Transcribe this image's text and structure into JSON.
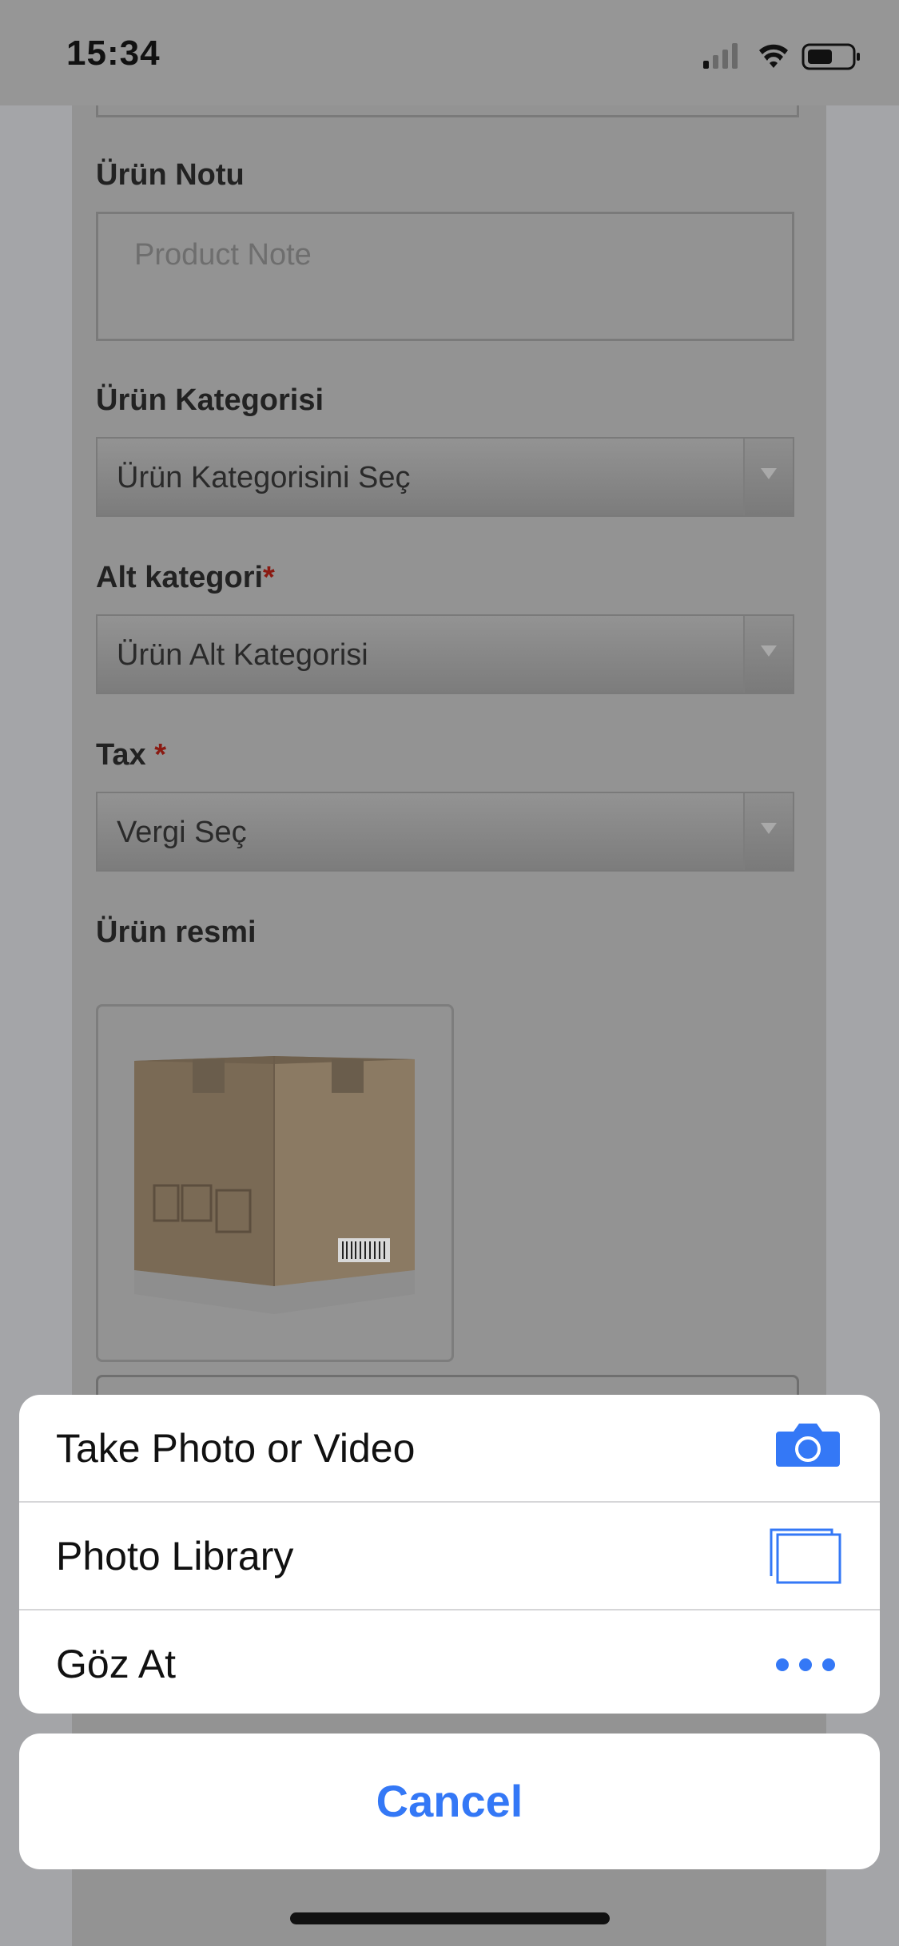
{
  "status_bar": {
    "time": "15:34"
  },
  "form": {
    "note_label": "Ürün Notu",
    "note_placeholder": "Product Note",
    "category_label": "Ürün Kategorisi",
    "category_value": "Ürün Kategorisini Seç",
    "subcategory_label": "Alt kategori",
    "subcategory_required": "*",
    "subcategory_value": "Ürün Alt Kategorisi",
    "tax_label": "Tax",
    "tax_required": "*",
    "tax_value": "Vergi Seç",
    "image_label": "Ürün resmi"
  },
  "action_sheet": {
    "items": [
      {
        "label": "Take Photo or Video",
        "icon": "camera-icon"
      },
      {
        "label": "Photo Library",
        "icon": "photo-library-icon"
      },
      {
        "label": "Göz At",
        "icon": "more-dots-icon"
      }
    ],
    "cancel_label": "Cancel",
    "accent_color": "#3478f6"
  }
}
